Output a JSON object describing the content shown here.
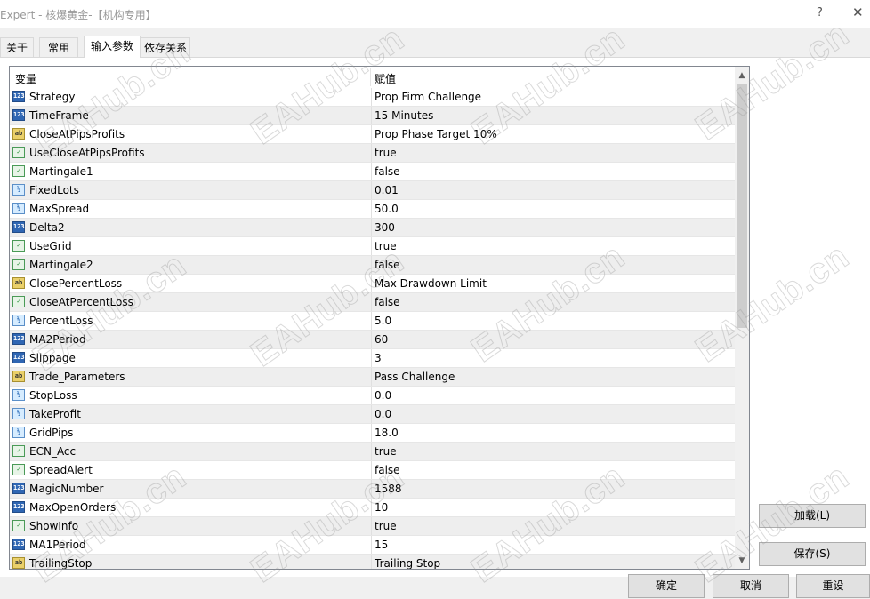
{
  "window": {
    "title": "Expert - 核爆黄金-【机构专用】",
    "help_label": "?",
    "close_label": "✕"
  },
  "tabs": [
    {
      "label": "关于"
    },
    {
      "label": "常用"
    },
    {
      "label": "输入参数"
    },
    {
      "label": "依存关系"
    }
  ],
  "grid": {
    "col_variable": "变量",
    "col_value": "赋值",
    "rows": [
      {
        "type": "num",
        "icon": "123",
        "name": "Strategy",
        "value": "Prop Firm Challenge"
      },
      {
        "type": "num",
        "icon": "123",
        "name": "TimeFrame",
        "value": "15 Minutes"
      },
      {
        "type": "str",
        "icon": "ab",
        "name": "CloseAtPipsProfits",
        "value": "Prop Phase Target 10%"
      },
      {
        "type": "bool",
        "icon": "✓",
        "name": "UseCloseAtPipsProfits",
        "value": "true"
      },
      {
        "type": "bool",
        "icon": "✓",
        "name": "Martingale1",
        "value": "false"
      },
      {
        "type": "dbl",
        "icon": "½",
        "name": "FixedLots",
        "value": "0.01"
      },
      {
        "type": "dbl",
        "icon": "½",
        "name": "MaxSpread",
        "value": "50.0"
      },
      {
        "type": "num",
        "icon": "123",
        "name": "Delta2",
        "value": "300"
      },
      {
        "type": "bool",
        "icon": "✓",
        "name": "UseGrid",
        "value": "true"
      },
      {
        "type": "bool",
        "icon": "✓",
        "name": "Martingale2",
        "value": "false"
      },
      {
        "type": "str",
        "icon": "ab",
        "name": "ClosePercentLoss",
        "value": " Max Drawdown Limit"
      },
      {
        "type": "bool",
        "icon": "✓",
        "name": "CloseAtPercentLoss",
        "value": "false"
      },
      {
        "type": "dbl",
        "icon": "½",
        "name": "PercentLoss",
        "value": "5.0"
      },
      {
        "type": "num",
        "icon": "123",
        "name": "MA2Period",
        "value": "60"
      },
      {
        "type": "num",
        "icon": "123",
        "name": "Slippage",
        "value": "3"
      },
      {
        "type": "str",
        "icon": "ab",
        "name": "Trade_Parameters",
        "value": "Pass Challenge"
      },
      {
        "type": "dbl",
        "icon": "½",
        "name": "StopLoss",
        "value": "0.0"
      },
      {
        "type": "dbl",
        "icon": "½",
        "name": "TakeProfit",
        "value": "0.0"
      },
      {
        "type": "dbl",
        "icon": "½",
        "name": "GridPips",
        "value": "18.0"
      },
      {
        "type": "bool",
        "icon": "✓",
        "name": "ECN_Acc",
        "value": "true"
      },
      {
        "type": "bool",
        "icon": "✓",
        "name": "SpreadAlert",
        "value": "false"
      },
      {
        "type": "num",
        "icon": "123",
        "name": "MagicNumber",
        "value": "1588"
      },
      {
        "type": "num",
        "icon": "123",
        "name": "MaxOpenOrders",
        "value": "10"
      },
      {
        "type": "bool",
        "icon": "✓",
        "name": "ShowInfo",
        "value": "true"
      },
      {
        "type": "num",
        "icon": "123",
        "name": "MA1Period",
        "value": "15"
      },
      {
        "type": "str",
        "icon": "ab",
        "name": "TrailingStop",
        "value": " Trailing Stop"
      }
    ]
  },
  "buttons": {
    "load": "加载(L)",
    "save": "保存(S)",
    "ok": "确定",
    "cancel": "取消",
    "reset": "重设"
  },
  "watermark": "EAHub.cn",
  "scroll": {
    "up_icon": "▲",
    "down_icon": "▼"
  }
}
